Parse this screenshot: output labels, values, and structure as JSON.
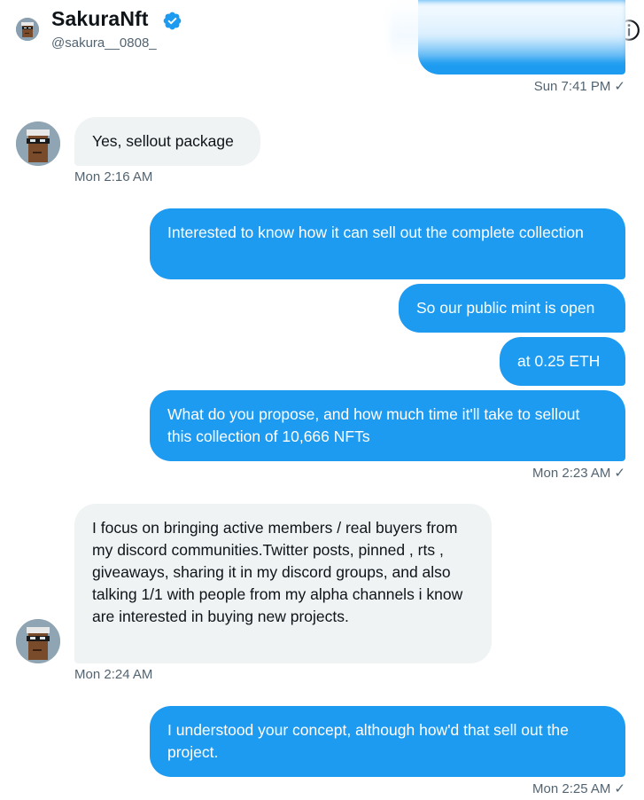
{
  "header": {
    "name": "SakuraNft",
    "handle": "@sakura__0808_",
    "verified_icon": "verified-badge-icon",
    "info_icon": "info-icon"
  },
  "colors": {
    "outgoing": "#1d9bf0",
    "incoming": "#eff3f4",
    "muted": "#536471"
  },
  "messages": [
    {
      "direction": "out",
      "text": "",
      "hidden": true
    },
    {
      "direction": "in",
      "text": "Yes, sellout package"
    },
    {
      "direction": "out",
      "text": "Interested to know how it can sell out the complete collection"
    },
    {
      "direction": "out",
      "text": "So our public mint is open"
    },
    {
      "direction": "out",
      "text": "at 0.25 ETH"
    },
    {
      "direction": "out",
      "text": "What do you propose, and how much time it'll take to sellout this collection of 10,666 NFTs"
    },
    {
      "direction": "in",
      "text": "I focus on bringing active members / real buyers from my discord communities.Twitter posts, pinned , rts , giveaways, sharing it in my discord groups, and also talking 1/1 with people from my alpha channels i know are interested in buying new projects."
    },
    {
      "direction": "out",
      "text": "I understood your concept, although how'd that sell out the project."
    }
  ],
  "timestamps": {
    "t1": "Sun 7:41 PM",
    "t2": "Mon 2:16 AM",
    "t3": "Mon 2:23 AM",
    "t4": "Mon 2:24 AM",
    "t5": "Mon 2:25 AM"
  },
  "read_mark": "✓"
}
